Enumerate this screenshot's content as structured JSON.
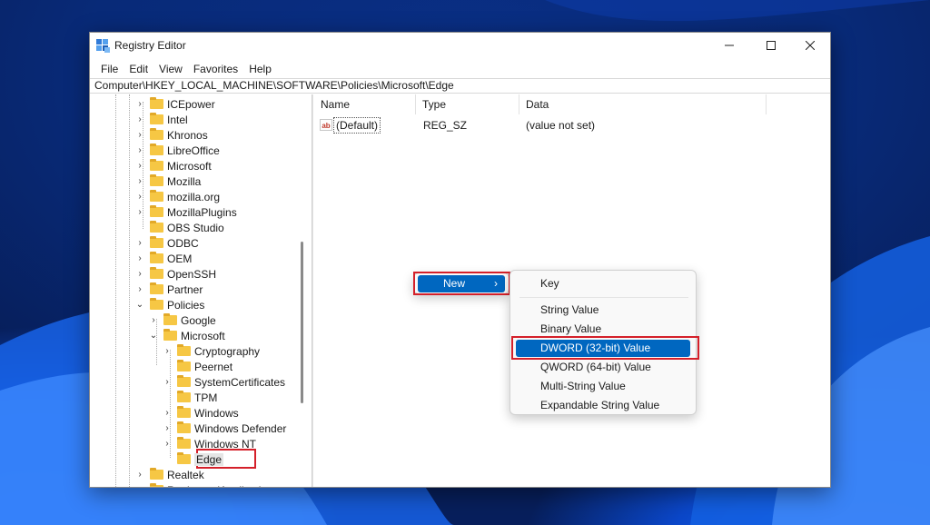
{
  "window": {
    "title": "Registry Editor",
    "controls": {
      "minimize": "—",
      "maximize": "☐",
      "close": "✕"
    }
  },
  "menubar": [
    "File",
    "Edit",
    "View",
    "Favorites",
    "Help"
  ],
  "address": "Computer\\HKEY_LOCAL_MACHINE\\SOFTWARE\\Policies\\Microsoft\\Edge",
  "tree": [
    {
      "label": "ICEpower",
      "level": 0,
      "expander": "›"
    },
    {
      "label": "Intel",
      "level": 0,
      "expander": "›"
    },
    {
      "label": "Khronos",
      "level": 0,
      "expander": "›"
    },
    {
      "label": "LibreOffice",
      "level": 0,
      "expander": "›"
    },
    {
      "label": "Microsoft",
      "level": 0,
      "expander": "›"
    },
    {
      "label": "Mozilla",
      "level": 0,
      "expander": "›"
    },
    {
      "label": "mozilla.org",
      "level": 0,
      "expander": "›"
    },
    {
      "label": "MozillaPlugins",
      "level": 0,
      "expander": "›"
    },
    {
      "label": "OBS Studio",
      "level": 0,
      "expander": ""
    },
    {
      "label": "ODBC",
      "level": 0,
      "expander": "›"
    },
    {
      "label": "OEM",
      "level": 0,
      "expander": "›"
    },
    {
      "label": "OpenSSH",
      "level": 0,
      "expander": "›"
    },
    {
      "label": "Partner",
      "level": 0,
      "expander": "›"
    },
    {
      "label": "Policies",
      "level": 0,
      "expander": "⌄"
    },
    {
      "label": "Google",
      "level": 1,
      "expander": "›"
    },
    {
      "label": "Microsoft",
      "level": 1,
      "expander": "⌄"
    },
    {
      "label": "Cryptography",
      "level": 2,
      "expander": "›"
    },
    {
      "label": "Peernet",
      "level": 2,
      "expander": ""
    },
    {
      "label": "SystemCertificates",
      "level": 2,
      "expander": "›"
    },
    {
      "label": "TPM",
      "level": 2,
      "expander": ""
    },
    {
      "label": "Windows",
      "level": 2,
      "expander": "›"
    },
    {
      "label": "Windows Defender",
      "level": 2,
      "expander": "›"
    },
    {
      "label": "Windows NT",
      "level": 2,
      "expander": "›"
    },
    {
      "label": "Edge",
      "level": 2,
      "expander": "",
      "selected": true
    },
    {
      "label": "Realtek",
      "level": 0,
      "expander": "›"
    },
    {
      "label": "RegisteredApplications",
      "level": 0,
      "expander": "›"
    }
  ],
  "list": {
    "columns": [
      "Name",
      "Type",
      "Data"
    ],
    "rows": [
      {
        "icon": "ab",
        "name": "(Default)",
        "type": "REG_SZ",
        "data": "(value not set)"
      }
    ]
  },
  "context_menu": {
    "new_label": "New",
    "submenu_arrow": "›",
    "submenu": [
      "Key",
      "String Value",
      "Binary Value",
      "DWORD (32-bit) Value",
      "QWORD (64-bit) Value",
      "Multi-String Value",
      "Expandable String Value"
    ],
    "selected_item": "DWORD (32-bit) Value"
  },
  "colors": {
    "accent": "#0067c0",
    "highlight": "#d4202a",
    "folder": "#f6c744"
  }
}
